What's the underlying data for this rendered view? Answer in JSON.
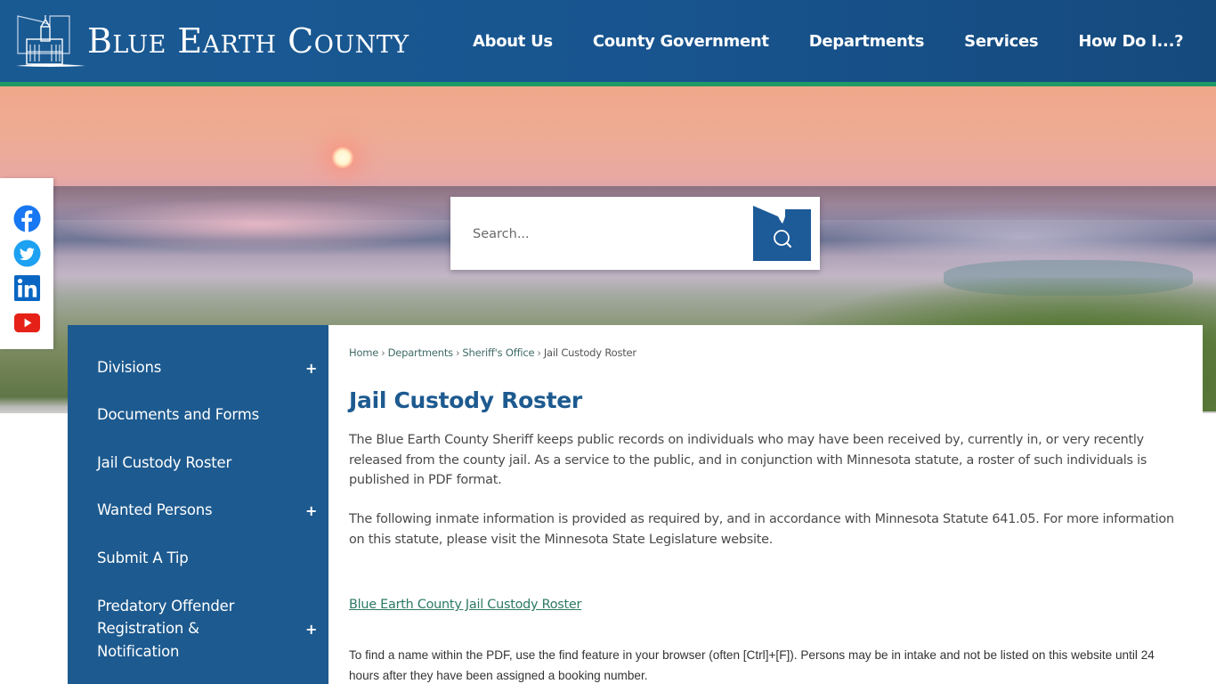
{
  "header": {
    "site_title": "Blue Earth County",
    "nav": [
      {
        "label": "About Us"
      },
      {
        "label": "County Government"
      },
      {
        "label": "Departments"
      },
      {
        "label": "Services"
      },
      {
        "label": "How Do I...?"
      }
    ],
    "colors": {
      "brand_blue": "#1a5a93",
      "accent_green": "#1f9a66"
    }
  },
  "social": [
    {
      "name": "Facebook",
      "icon": "facebook-icon",
      "color": "#1877f2"
    },
    {
      "name": "Twitter",
      "icon": "twitter-icon",
      "color": "#1da1f2"
    },
    {
      "name": "LinkedIn",
      "icon": "linkedin-icon",
      "color": "#0a66c2"
    },
    {
      "name": "YouTube",
      "icon": "youtube-icon",
      "color": "#e62117"
    }
  ],
  "search": {
    "placeholder": "Search...",
    "value": "",
    "button_icon": "search-icon"
  },
  "sidebar": {
    "items": [
      {
        "label": "Divisions",
        "expandable": true,
        "expand_symbol": "+"
      },
      {
        "label": "Documents and Forms",
        "expandable": false
      },
      {
        "label": "Jail Custody Roster",
        "expandable": false
      },
      {
        "label": "Wanted Persons",
        "expandable": true,
        "expand_symbol": "+"
      },
      {
        "label": "Submit A Tip",
        "expandable": false
      },
      {
        "label": "Predatory Offender Registration & Notification",
        "expandable": true,
        "expand_symbol": "+"
      }
    ]
  },
  "breadcrumb": {
    "items": [
      {
        "label": "Home"
      },
      {
        "label": "Departments"
      },
      {
        "label": "Sheriff's Office"
      }
    ],
    "separator": "›",
    "current": "Jail Custody Roster"
  },
  "main": {
    "title": "Jail Custody Roster",
    "paragraph1": "The Blue Earth County Sheriff keeps public records on individuals who may have been received by, currently in, or very recently released from the county jail. As a service to the public, and in conjunction with Minnesota statute, a roster of such individuals is published in PDF format.",
    "paragraph2": "The following inmate information is provided as required by, and in accordance with Minnesota Statute 641.05. For more information on this statute, please visit the Minnesota State Legislature website.",
    "pdf_link": "Blue Earth County Jail Custody Roster",
    "note": "To find a name within the PDF, use the find feature in your browser (often [Ctrl]+[F]). Persons may be in intake and not be listed on this website until 24 hours after they have been assigned a booking number."
  }
}
